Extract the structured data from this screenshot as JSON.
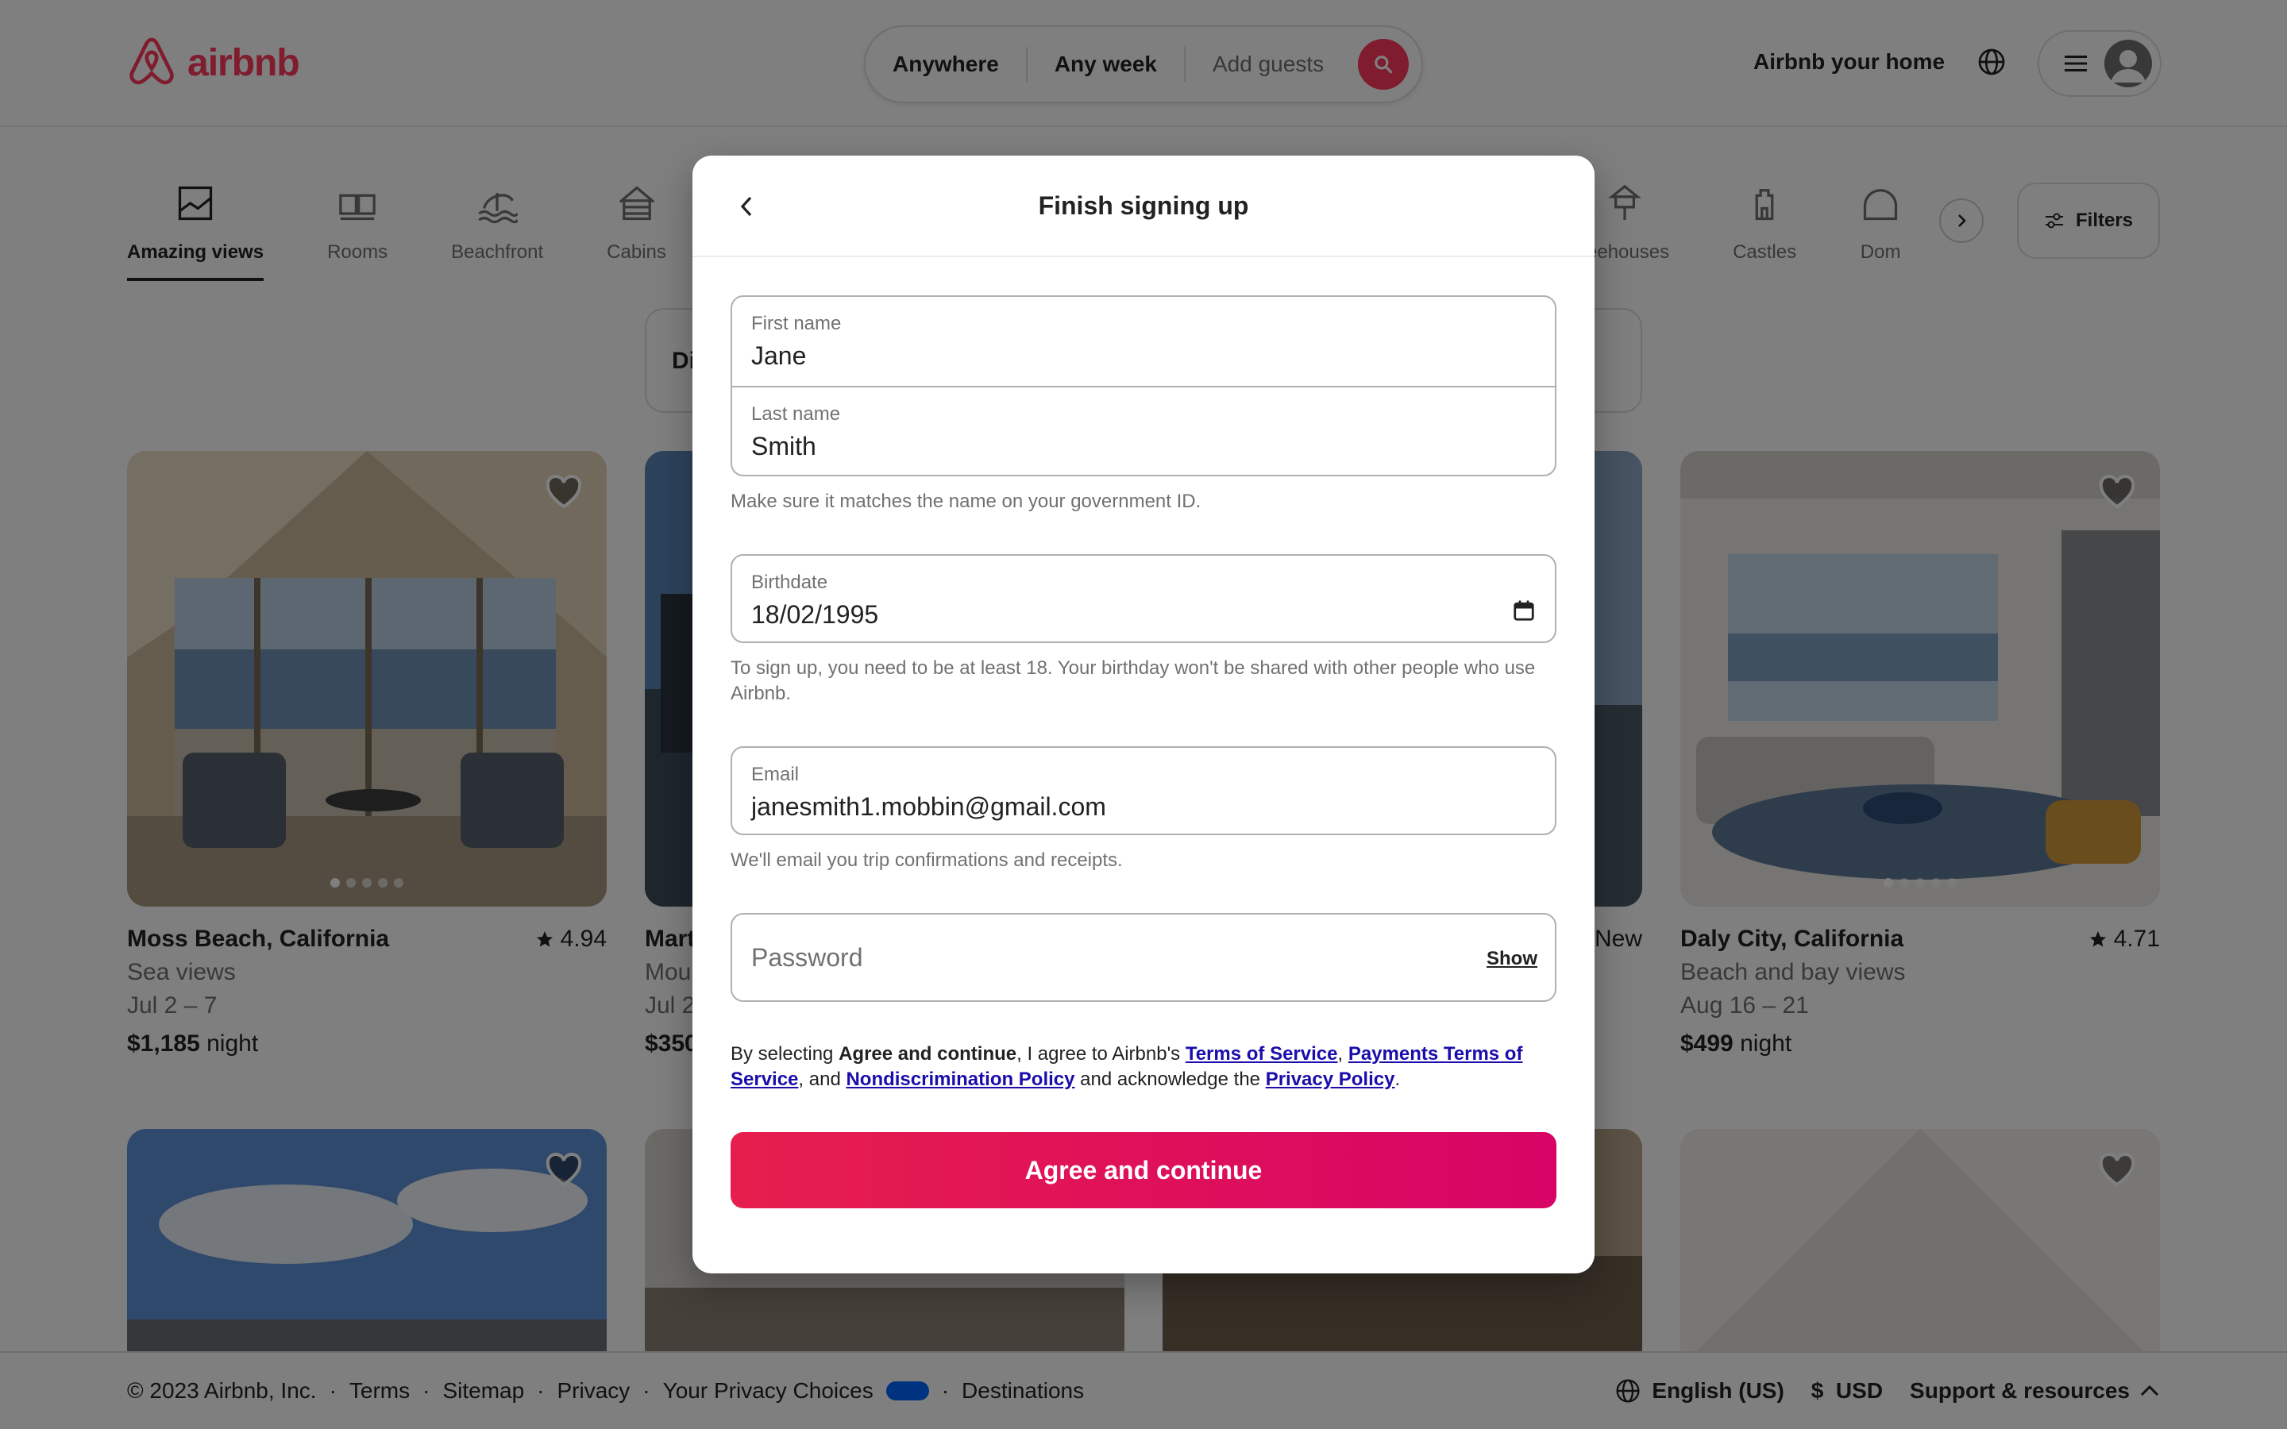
{
  "header": {
    "logo_text": "airbnb",
    "search": {
      "where": "Anywhere",
      "when": "Any week",
      "guests": "Add guests"
    },
    "host_link": "Airbnb your home"
  },
  "categories": {
    "left": [
      {
        "label": "Amazing views",
        "icon": "amazing-views-icon",
        "active": true
      },
      {
        "label": "Rooms",
        "icon": "rooms-icon"
      },
      {
        "label": "Beachfront",
        "icon": "beachfront-icon"
      },
      {
        "label": "Cabins",
        "icon": "cabins-icon"
      }
    ],
    "right": [
      {
        "label": "reehouses",
        "icon": "treehouses-icon"
      },
      {
        "label": "Castles",
        "icon": "castles-icon"
      },
      {
        "label": "Dom",
        "icon": "domes-icon"
      }
    ],
    "filters_label": "Filters"
  },
  "price_bar": {
    "text": "Di"
  },
  "listings": [
    {
      "title": "Moss Beach, California",
      "rating": "4.94",
      "subtitle": "Sea views",
      "dates": "Jul 2 – 7",
      "price": "$1,185",
      "price_unit": "night"
    },
    {
      "title": "Mart",
      "subtitle": "Mou",
      "dates": "Jul 2",
      "price": "$350"
    },
    {
      "rating": "New"
    },
    {
      "title": "Daly City, California",
      "rating": "4.71",
      "subtitle": "Beach and bay views",
      "dates": "Aug 16 – 21",
      "price": "$499",
      "price_unit": "night"
    }
  ],
  "footer": {
    "copyright": "© 2023 Airbnb, Inc.",
    "links": [
      "Terms",
      "Sitemap",
      "Privacy",
      "Your Privacy Choices",
      "Destinations"
    ],
    "language": "English (US)",
    "currency": "$  USD",
    "support": "Support & resources"
  },
  "modal": {
    "title": "Finish signing up",
    "first_name": {
      "label": "First name",
      "value": "Jane"
    },
    "last_name": {
      "label": "Last name",
      "value": "Smith"
    },
    "name_hint": "Make sure it matches the name on your government ID.",
    "birthdate": {
      "label": "Birthdate",
      "value": "18/02/1995"
    },
    "birthdate_hint": "To sign up, you need to be at least 18. Your birthday won't be shared with other people who use Airbnb.",
    "email": {
      "label": "Email",
      "value": "janesmith1.mobbin@gmail.com"
    },
    "email_hint": "We'll email you trip confirmations and receipts.",
    "password": {
      "placeholder": "Password",
      "show_label": "Show"
    },
    "legal": {
      "prefix": "By selecting ",
      "bold": "Agree and continue",
      "mid1": ", I agree to Airbnb's ",
      "tos": "Terms of Service",
      "comma": ", ",
      "payments": "Payments Terms of Service",
      "and": ", and ",
      "nondiscrimination": "Nondiscrimination Policy",
      "acknowledge": " and acknowledge the ",
      "privacy": "Privacy Policy",
      "end": "."
    },
    "cta": "Agree and continue"
  },
  "colors": {
    "brand": "#ff385c",
    "cta_start": "#e61e4d",
    "cta_end": "#d70466",
    "link": "#1a0dab"
  }
}
